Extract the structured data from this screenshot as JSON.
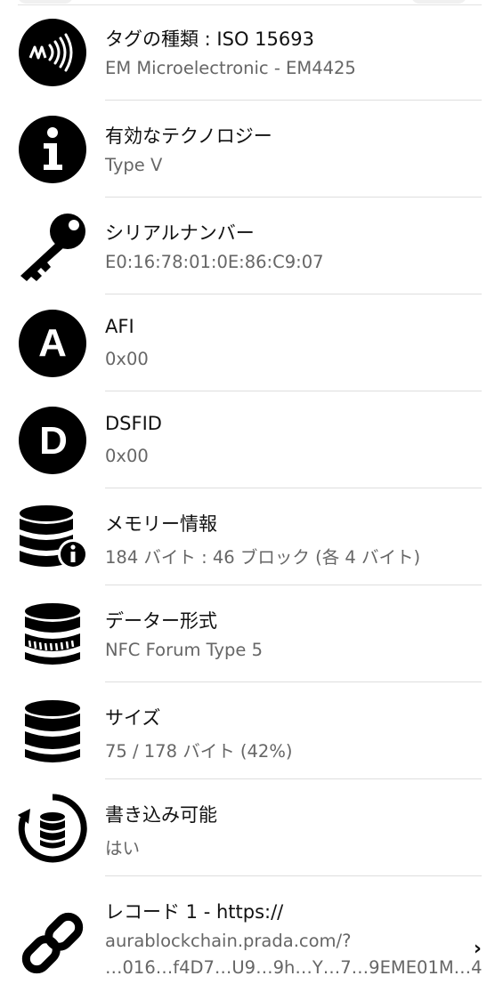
{
  "rows": [
    {
      "icon": "nfc-tag-icon",
      "title": "タグの種類 : ISO 15693",
      "value": "EM Microelectronic - EM4425"
    },
    {
      "icon": "info-icon",
      "title": "有効なテクノロジー",
      "value": "Type V"
    },
    {
      "icon": "key-icon",
      "title": "シリアルナンバー",
      "value": "E0:16:78:01:0E:86:C9:07"
    },
    {
      "icon": "letter-a-icon",
      "title": "AFI",
      "value": "0x00"
    },
    {
      "icon": "letter-d-icon",
      "title": "DSFID",
      "value": "0x00"
    },
    {
      "icon": "database-info-icon",
      "title": "メモリー情報",
      "value": "184 バイト : 46 ブロック (各 4 バイト)"
    },
    {
      "icon": "database-format-icon",
      "title": "データー形式",
      "value": "NFC Forum Type 5"
    },
    {
      "icon": "database-icon",
      "title": "サイズ",
      "value": "75 / 178 バイト (42%)"
    },
    {
      "icon": "rewrite-database-icon",
      "title": "書き込み可能",
      "value": "はい"
    },
    {
      "icon": "link-icon",
      "title": "レコード 1 - https://",
      "value": "aurablockchain.prada.com/?",
      "value_cut": "…016…f4D7…U9…9h…Y…7…9EME01M…4"
    }
  ]
}
